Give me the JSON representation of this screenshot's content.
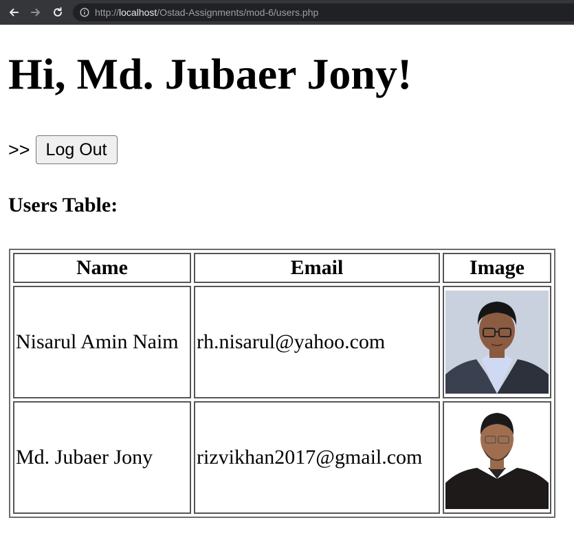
{
  "browser": {
    "url_prefix": "http://",
    "url_host": "localhost",
    "url_path": "/Ostad-Assignments/mod-6/users.php"
  },
  "page": {
    "greeting": "Hi, Md. Jubaer Jony!",
    "logout_prefix": ">>",
    "logout_label": "Log Out",
    "table_title": "Users Table:"
  },
  "table": {
    "headers": {
      "name": "Name",
      "email": "Email",
      "image": "Image"
    },
    "rows": [
      {
        "name": "Nisarul Amin Naim",
        "email": "rh.nisarul@yahoo.com",
        "image_bg": "#c9d0de"
      },
      {
        "name": "Md. Jubaer Jony",
        "email": "rizvikhan2017@gmail.com",
        "image_bg": "#ffffff"
      }
    ]
  }
}
